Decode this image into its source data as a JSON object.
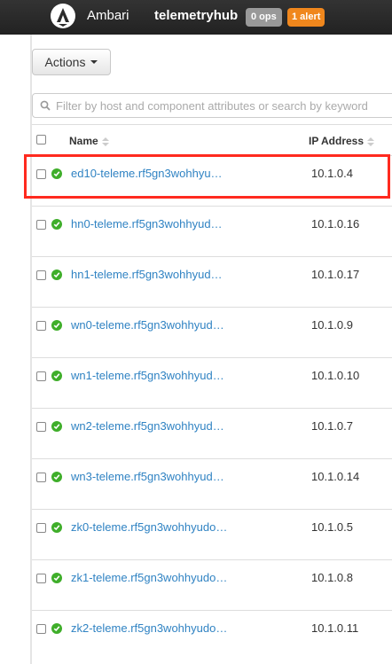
{
  "navbar": {
    "brand": "Ambari",
    "cluster": "telemetryhub",
    "ops_badge": "0 ops",
    "alert_badge": "1 alert"
  },
  "toolbar": {
    "actions_label": "Actions"
  },
  "search": {
    "placeholder": "Filter by host and component attributes or search by keyword"
  },
  "table": {
    "columns": [
      "Name",
      "IP Address"
    ],
    "rows": [
      {
        "name": "ed10-teleme.rf5gn3wohhyu…",
        "ip": "10.1.0.4"
      },
      {
        "name": "hn0-teleme.rf5gn3wohhyud…",
        "ip": "10.1.0.16"
      },
      {
        "name": "hn1-teleme.rf5gn3wohhyud…",
        "ip": "10.1.0.17"
      },
      {
        "name": "wn0-teleme.rf5gn3wohhyud…",
        "ip": "10.1.0.9"
      },
      {
        "name": "wn1-teleme.rf5gn3wohhyud…",
        "ip": "10.1.0.10"
      },
      {
        "name": "wn2-teleme.rf5gn3wohhyud…",
        "ip": "10.1.0.7"
      },
      {
        "name": "wn3-teleme.rf5gn3wohhyud…",
        "ip": "10.1.0.14"
      },
      {
        "name": "zk0-teleme.rf5gn3wohhyudo…",
        "ip": "10.1.0.5"
      },
      {
        "name": "zk1-teleme.rf5gn3wohhyudo…",
        "ip": "10.1.0.8"
      },
      {
        "name": "zk2-teleme.rf5gn3wohhyudo…",
        "ip": "10.1.0.11"
      }
    ]
  },
  "colors": {
    "status_ok": "#3fae2a",
    "link": "#3083c3",
    "alert": "#f0871d",
    "highlight": "#ff2a1f"
  },
  "icons": {
    "logo": "ambari-logo-icon",
    "search": "search-icon",
    "status": "check-circle-icon"
  }
}
